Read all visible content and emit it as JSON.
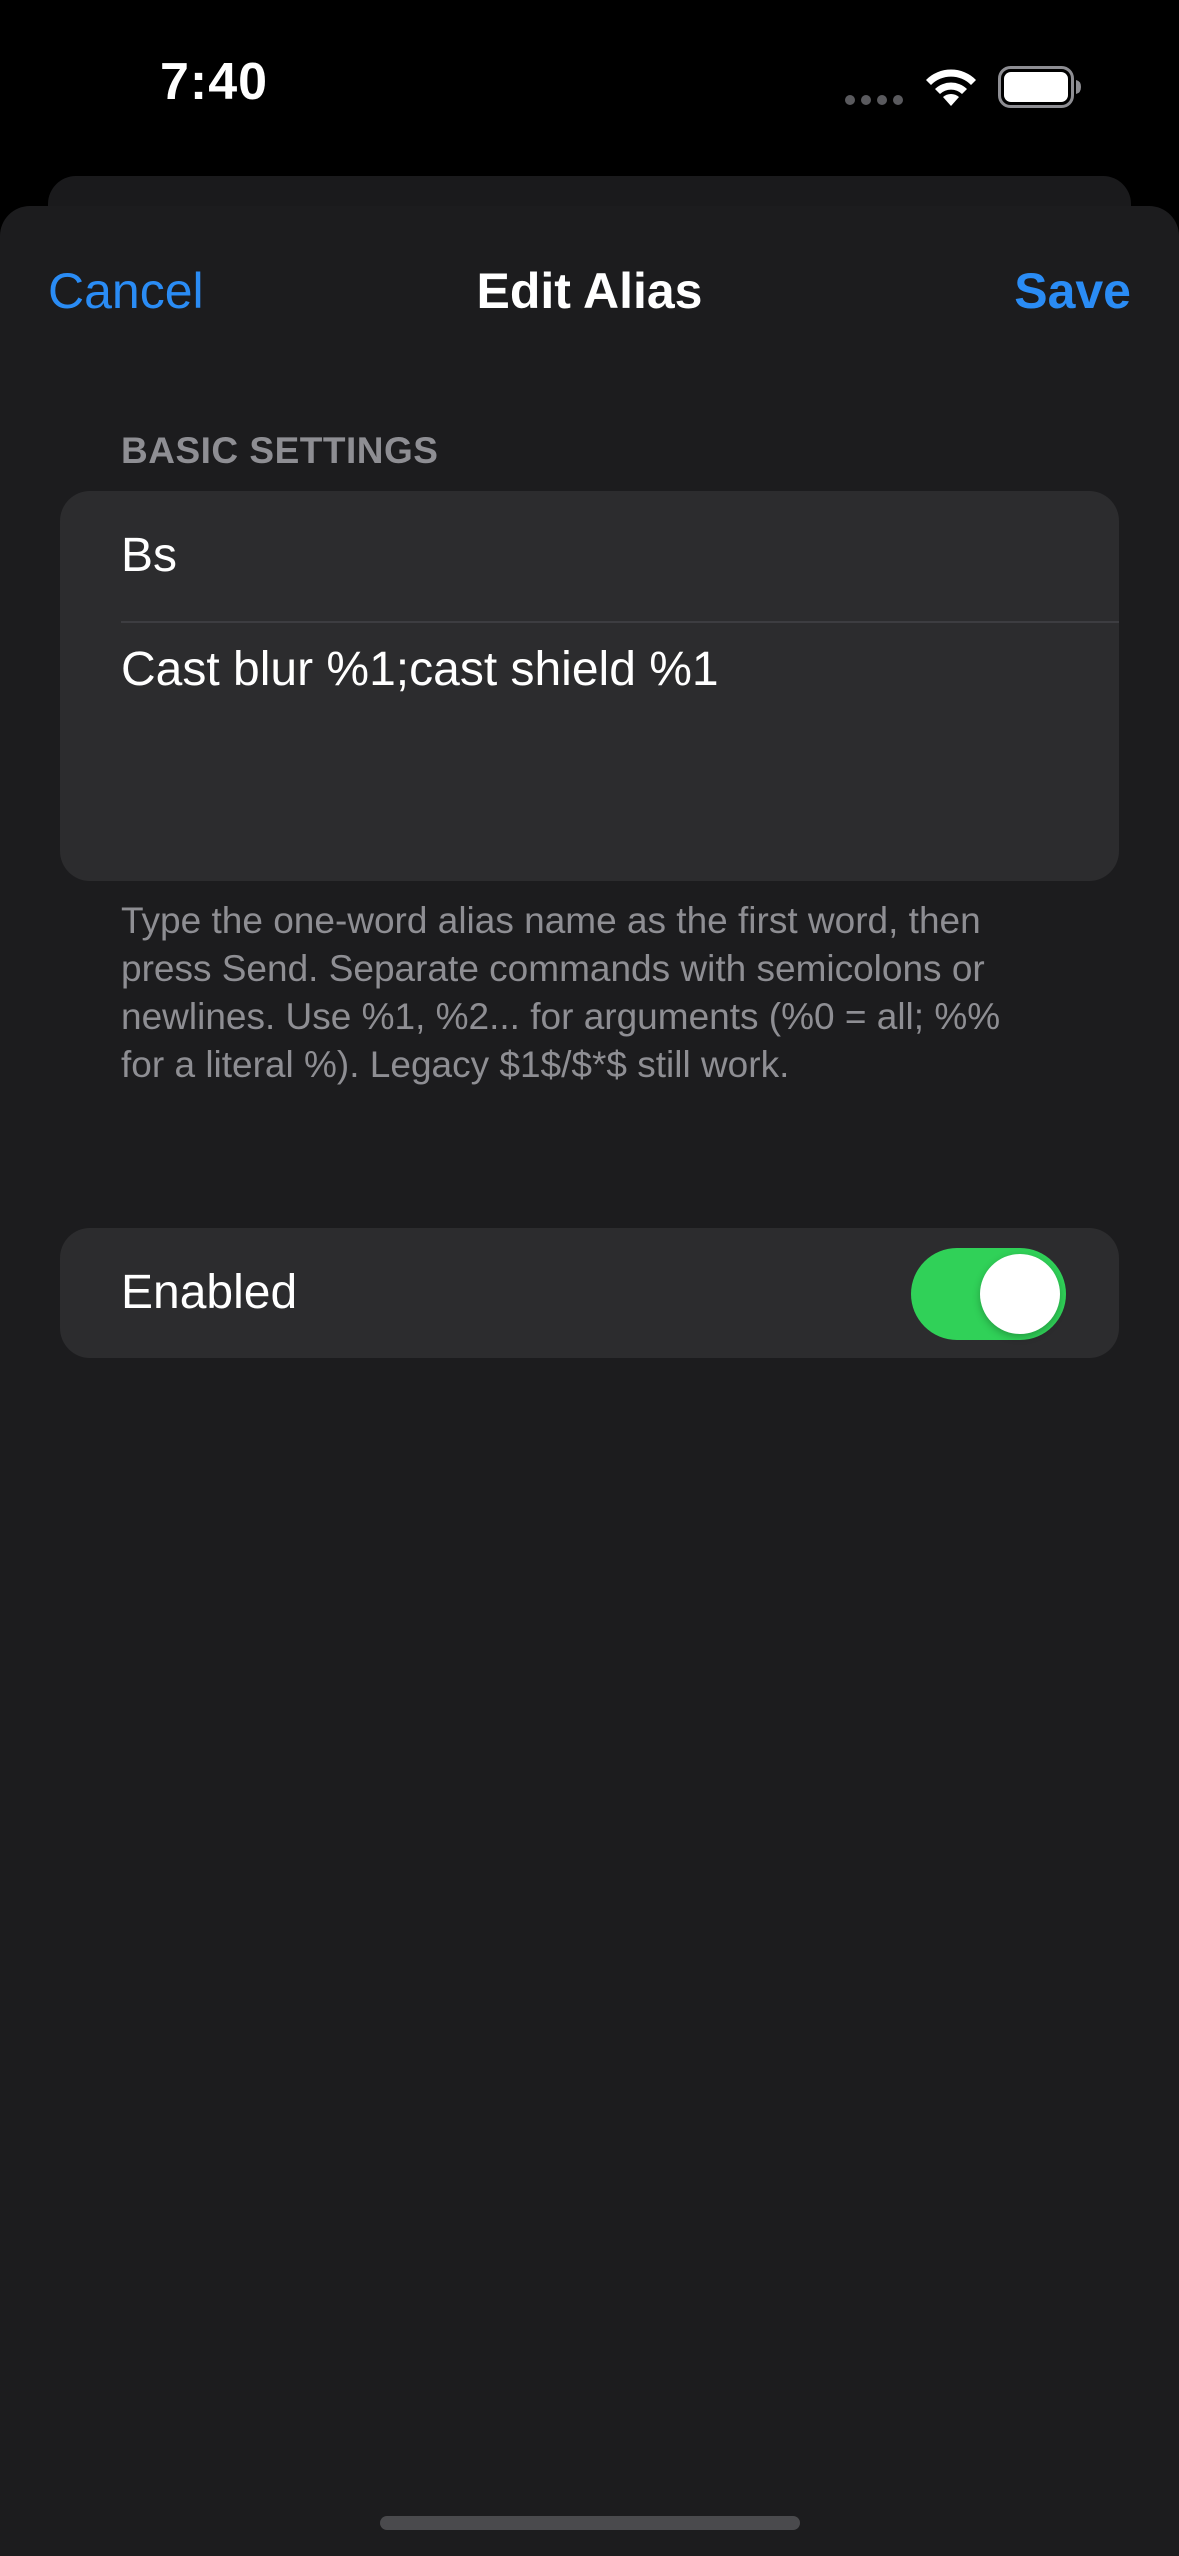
{
  "status_bar": {
    "time": "7:40",
    "icons": [
      "signal-dots-icon",
      "wifi-icon",
      "battery-icon"
    ]
  },
  "nav": {
    "cancel_label": "Cancel",
    "title": "Edit Alias",
    "save_label": "Save"
  },
  "basic_settings": {
    "header": "BASIC SETTINGS",
    "alias_name": "Bs",
    "alias_commands": "Cast blur %1;cast shield %1",
    "footer": "Type the one-word alias name as the first word, then press Send. Separate commands with semicolons or newlines. Use %1, %2... for arguments (%0 = all; %% for a literal %). Legacy $1$/$*$ still work."
  },
  "enabled_row": {
    "label": "Enabled",
    "value": true
  },
  "colors": {
    "accent": "#2a8cf5",
    "toggle_on": "#30d158",
    "background": "#1c1c1e",
    "cell": "#2c2c2e",
    "secondary_text": "#8e8e93"
  }
}
